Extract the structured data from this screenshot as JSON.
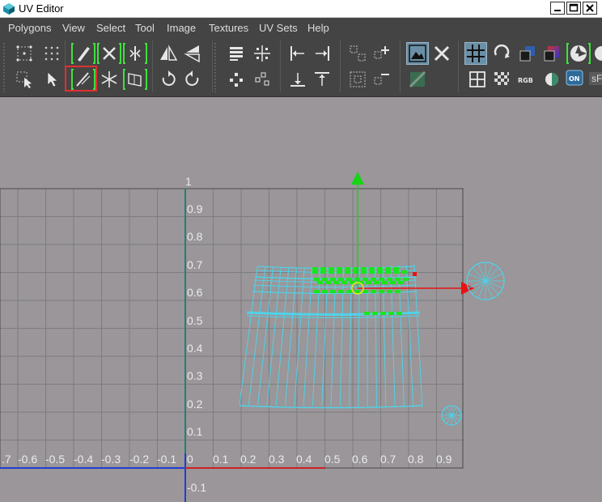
{
  "window": {
    "title": "UV Editor"
  },
  "menu": {
    "items": [
      "Polygons",
      "View",
      "Select",
      "Tool",
      "Image",
      "Textures",
      "UV Sets",
      "Help"
    ]
  },
  "toolbar": {
    "partial_label": "sF"
  },
  "viewport": {
    "y_axis_labels": [
      "1",
      "0.9",
      "0.8",
      "0.7",
      "0.6",
      "0.5",
      "0.4",
      "0.3",
      "0.2",
      "0.1"
    ],
    "y_axis_labels_negative": [
      "-0.1"
    ],
    "x_axis_labels_negative": [
      ".7",
      "-0.6",
      "-0.5",
      "-0.4",
      "-0.3",
      "-0.2",
      "-0.1"
    ],
    "x_axis_labels_positive": [
      "0",
      "0.1",
      "0.2",
      "0.3",
      "0.4",
      "0.5",
      "0.6",
      "0.7",
      "0.8",
      "0.9"
    ]
  },
  "colors": {
    "panel_bg": "#444444",
    "viewport_bg": "#9a9699",
    "grid_line": "#7c7c7e",
    "uv_wire": "#4fd2e8",
    "selected_uv": "#19e619",
    "manip_y": "#17d417",
    "manip_x": "#e81212",
    "axis_v": "#1f3fcf",
    "axis_u": "#cc2222",
    "highlight_box": "#e03030",
    "tool_icon_green": "#3fe03f"
  }
}
